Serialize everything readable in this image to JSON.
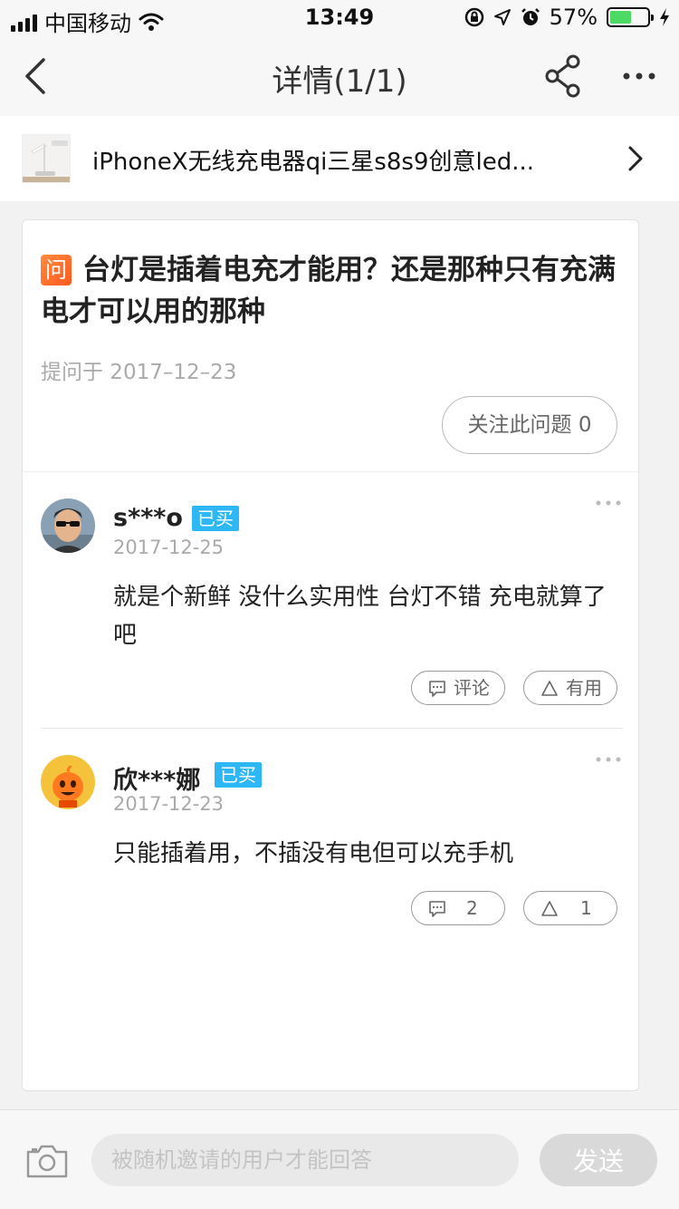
{
  "status_bar": {
    "carrier": "中国移动",
    "time": "13:49",
    "battery_percent": "57%",
    "battery_level": 0.57,
    "icons": [
      "signal-icon",
      "wifi-icon",
      "orientation-lock-icon",
      "location-icon",
      "alarm-icon",
      "battery-icon",
      "charging-icon"
    ]
  },
  "nav": {
    "title": "详情(1/1)",
    "icons": [
      "back-icon",
      "share-icon",
      "more-icon"
    ]
  },
  "product": {
    "name": "iPhoneX无线充电器qi三星s8s9创意led..."
  },
  "question": {
    "badge": "问",
    "text": "台灯是插着电充才能用？还是那种只有充满电才可以用的那种",
    "date": "提问于 2017–12–23",
    "follow_label": "关注此问题 0"
  },
  "answers": [
    {
      "user": "s***o",
      "badge": "已买",
      "date": "2017-12-25",
      "content": "就是个新鲜 没什么实用性   台灯不错   充电就算了吧",
      "comment_label": "评论",
      "useful_label": "有用"
    },
    {
      "user": "欣***娜",
      "badge": "已买",
      "date": "2017-12-23",
      "content": "只能插着用，不插没有电但可以充手机",
      "comment_label": "2",
      "useful_label": "1"
    }
  ],
  "bottom": {
    "placeholder": "被随机邀请的用户才能回答",
    "send_label": "发送"
  },
  "colors": {
    "accent_blue": "#2db7f5",
    "question_badge": "#ff6a2a",
    "battery_green": "#4cd964"
  }
}
